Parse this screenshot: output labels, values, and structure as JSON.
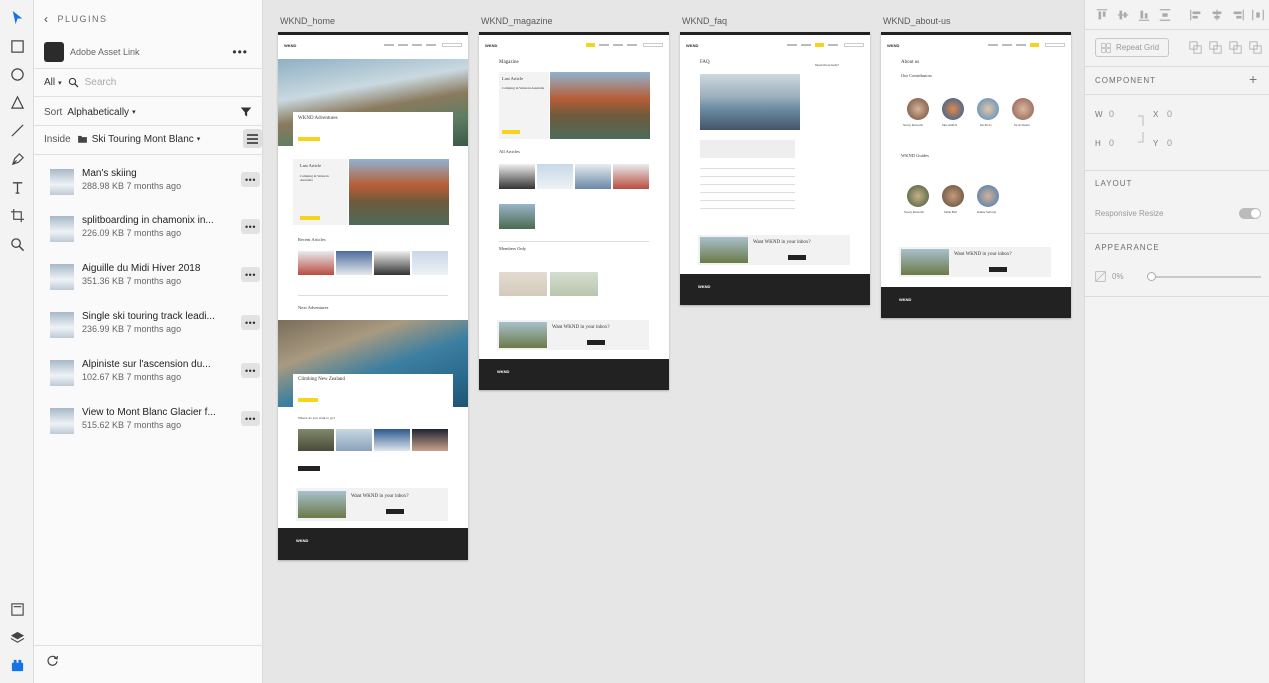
{
  "plugins_header": "PLUGINS",
  "plugin": {
    "name": "Adobe Asset Link",
    "more": "•••"
  },
  "filter": {
    "all": "All",
    "search_placeholder": "Search"
  },
  "sort": {
    "label": "Sort",
    "value": "Alphabetically"
  },
  "inside": {
    "label": "Inside",
    "folder": "Ski Touring Mont Blanc"
  },
  "assets": [
    {
      "name": "Man's skiing",
      "meta": "288.98 KB 7 months ago"
    },
    {
      "name": "splitboarding in chamonix in...",
      "meta": "226.09 KB 7 months ago"
    },
    {
      "name": "Aiguille du Midi Hiver 2018",
      "meta": "351.36 KB 7 months ago"
    },
    {
      "name": "Single ski touring track leadi...",
      "meta": "236.99 KB 7 months ago"
    },
    {
      "name": "Alpiniste sur l'ascension du...",
      "meta": "102.67 KB 7 months ago"
    },
    {
      "name": "View to Mont Blanc Glacier f...",
      "meta": "515.62 KB 7 months ago"
    }
  ],
  "asset_more": "•••",
  "artboards": [
    {
      "label": "WKND_home"
    },
    {
      "label": "WKND_magazine"
    },
    {
      "label": "WKND_faq"
    },
    {
      "label": "WKND_about-us"
    }
  ],
  "logo": "WKND",
  "home": {
    "hero_title": "WKND Adventures",
    "last": "Last Article",
    "last_sub": "Camping in Western Australia",
    "recent": "Recent Articles",
    "next": "Next Adventures",
    "climb": "Climbing New Zealand",
    "where": "Where do you want to go?",
    "newsletter": "Want WKND in your inbox?"
  },
  "magazine": {
    "title": "Magazine",
    "last": "Last Article",
    "last_sub": "Camping in Western Australia",
    "all": "All Articles",
    "members": "Members Only",
    "newsletter": "Want WKND in your inbox?"
  },
  "faq": {
    "title": "FAQ",
    "help": "Need more help?",
    "newsletter": "Want WKND in your inbox?"
  },
  "about": {
    "title": "About us",
    "contributors": "Our Contributors",
    "guides": "WKND Guides",
    "names": [
      "Stacey Roswells",
      "Jake Aldrich",
      "Ian Provo",
      "Jacob Wester"
    ],
    "guide_names": [
      "Stacey Roswells",
      "Jamie Ball",
      "Kumar Selvaraj"
    ],
    "newsletter": "Want WKND in your inbox?"
  },
  "inspector": {
    "repeat_grid": "Repeat Grid",
    "component": "COMPONENT",
    "w_label": "W",
    "w": "0",
    "x_label": "X",
    "x": "0",
    "h_label": "H",
    "h": "0",
    "y_label": "Y",
    "y": "0",
    "layout": "LAYOUT",
    "responsive": "Responsive Resize",
    "appearance": "APPEARANCE",
    "opacity": "0%"
  }
}
